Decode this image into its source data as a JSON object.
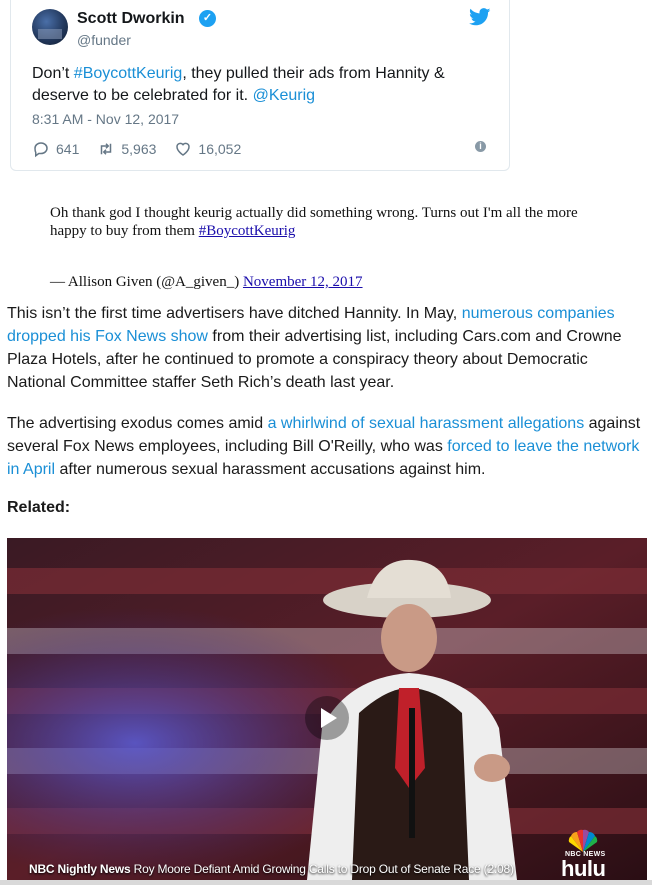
{
  "tweet": {
    "author_name": "Scott Dworkin",
    "handle": "@funder",
    "text_before": "Don’t ",
    "hashtag": "#BoycottKeurig",
    "text_middle": ", they pulled their ads from Hannity & deserve to be celebrated for it. ",
    "mention": "@Keurig",
    "timestamp": "8:31 AM - Nov 12, 2017",
    "replies": "641",
    "retweets": "5,963",
    "likes": "16,052",
    "icons": [
      "avatar",
      "verified-badge-icon",
      "twitter-bird-icon",
      "reply-icon",
      "retweet-icon",
      "like-heart-icon",
      "info-icon"
    ],
    "accent_color": "#1da1f2"
  },
  "blockquote": {
    "text": "Oh thank god I thought keurig actually did something wrong. Turns out I'm all the more happy to buy from them ",
    "hashtag": "#BoycottKeurig",
    "attribution": "— Allison Given (@A_given_) ",
    "date_link": "November 12, 2017"
  },
  "article": {
    "p1_a": "This isn’t the first time advertisers have ditched Hannity. In May, ",
    "p1_link": "numerous companies dropped his Fox News show",
    "p1_b": " from their advertising list, including Cars.com and Crowne Plaza Hotels, after he continued to promote a conspiracy theory about Democratic National Committee staffer Seth Rich’s death last year.",
    "p2_a": "The advertising exodus comes amid ",
    "p2_link1": "a whirlwind of sexual harassment allegations",
    "p2_b": " against several Fox News employees, including Bill O'Reilly, who was ",
    "p2_link2": "forced to leave the network in April",
    "p2_c": " after numerous sexual harassment accusations against him.",
    "related_label": "Related:",
    "link_color": "#1a8fd6"
  },
  "video": {
    "source": "NBC Nightly News",
    "title": "Roy Moore Defiant Amid Growing Calls to Drop Out of Senate Race (2:08)",
    "network_label": "NBC NEWS",
    "platform": "hulu",
    "icons": [
      "play-icon",
      "nbc-peacock-icon"
    ]
  }
}
